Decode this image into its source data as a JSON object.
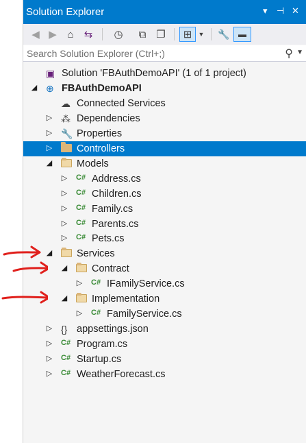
{
  "window": {
    "title": "Solution Explorer",
    "controls": [
      "▾",
      "⊣",
      "✕"
    ]
  },
  "toolbar": {
    "buttons": [
      {
        "icon": "back-icon",
        "glyph": "◀"
      },
      {
        "icon": "forward-icon",
        "glyph": "▶"
      },
      {
        "icon": "home-icon",
        "glyph": "⌂"
      },
      {
        "icon": "switch-views-icon",
        "glyph": "⇆"
      },
      {
        "icon": "pending-changes-icon",
        "glyph": "◷"
      },
      {
        "icon": "collapse-all-icon",
        "glyph": "⧉"
      },
      {
        "icon": "show-all-files-icon",
        "glyph": "❐"
      },
      {
        "icon": "sync-active-document-icon",
        "glyph": "⊞"
      },
      {
        "icon": "properties-icon",
        "glyph": "🔧"
      },
      {
        "icon": "preview-icon",
        "glyph": "▬"
      }
    ]
  },
  "search": {
    "placeholder": "Search Solution Explorer (Ctrl+;)"
  },
  "tree": [
    {
      "label": "Solution 'FBAuthDemoAPI' (1 of 1 project)",
      "level": 0,
      "expander": "",
      "icon": "solution"
    },
    {
      "label": "FBAuthDemoAPI",
      "level": 0,
      "expander": "expanded",
      "icon": "project",
      "bold": true
    },
    {
      "label": "Connected Services",
      "level": 1,
      "expander": "",
      "icon": "connected"
    },
    {
      "label": "Dependencies",
      "level": 1,
      "expander": "collapsed",
      "icon": "dependencies"
    },
    {
      "label": "Properties",
      "level": 1,
      "expander": "collapsed",
      "icon": "properties"
    },
    {
      "label": "Controllers",
      "level": 1,
      "expander": "collapsed",
      "icon": "folder",
      "selected": true
    },
    {
      "label": "Models",
      "level": 1,
      "expander": "expanded",
      "icon": "folder-open"
    },
    {
      "label": "Address.cs",
      "level": 2,
      "expander": "collapsed",
      "icon": "cs"
    },
    {
      "label": "Children.cs",
      "level": 2,
      "expander": "collapsed",
      "icon": "cs"
    },
    {
      "label": "Family.cs",
      "level": 2,
      "expander": "collapsed",
      "icon": "cs"
    },
    {
      "label": "Parents.cs",
      "level": 2,
      "expander": "collapsed",
      "icon": "cs"
    },
    {
      "label": "Pets.cs",
      "level": 2,
      "expander": "collapsed",
      "icon": "cs"
    },
    {
      "label": "Services",
      "level": 1,
      "expander": "expanded",
      "icon": "folder-open"
    },
    {
      "label": "Contract",
      "level": 2,
      "expander": "expanded",
      "icon": "folder-open"
    },
    {
      "label": "IFamilyService.cs",
      "level": 3,
      "expander": "collapsed",
      "icon": "cs"
    },
    {
      "label": "Implementation",
      "level": 2,
      "expander": "expanded",
      "icon": "folder-open"
    },
    {
      "label": "FamilyService.cs",
      "level": 3,
      "expander": "collapsed",
      "icon": "cs"
    },
    {
      "label": "appsettings.json",
      "level": 1,
      "expander": "collapsed",
      "icon": "json"
    },
    {
      "label": "Program.cs",
      "level": 1,
      "expander": "collapsed",
      "icon": "cs"
    },
    {
      "label": "Startup.cs",
      "level": 1,
      "expander": "collapsed",
      "icon": "cs"
    },
    {
      "label": "WeatherForecast.cs",
      "level": 1,
      "expander": "collapsed",
      "icon": "cs"
    }
  ],
  "annotations": {
    "arrow_color": "#e0201c",
    "arrows_point_to": [
      "Services",
      "Contract",
      "Implementation"
    ]
  },
  "colors": {
    "accent": "#007acc",
    "selection": "#007acc",
    "cs_icon": "#388a34",
    "folder": "#dcb67a"
  }
}
